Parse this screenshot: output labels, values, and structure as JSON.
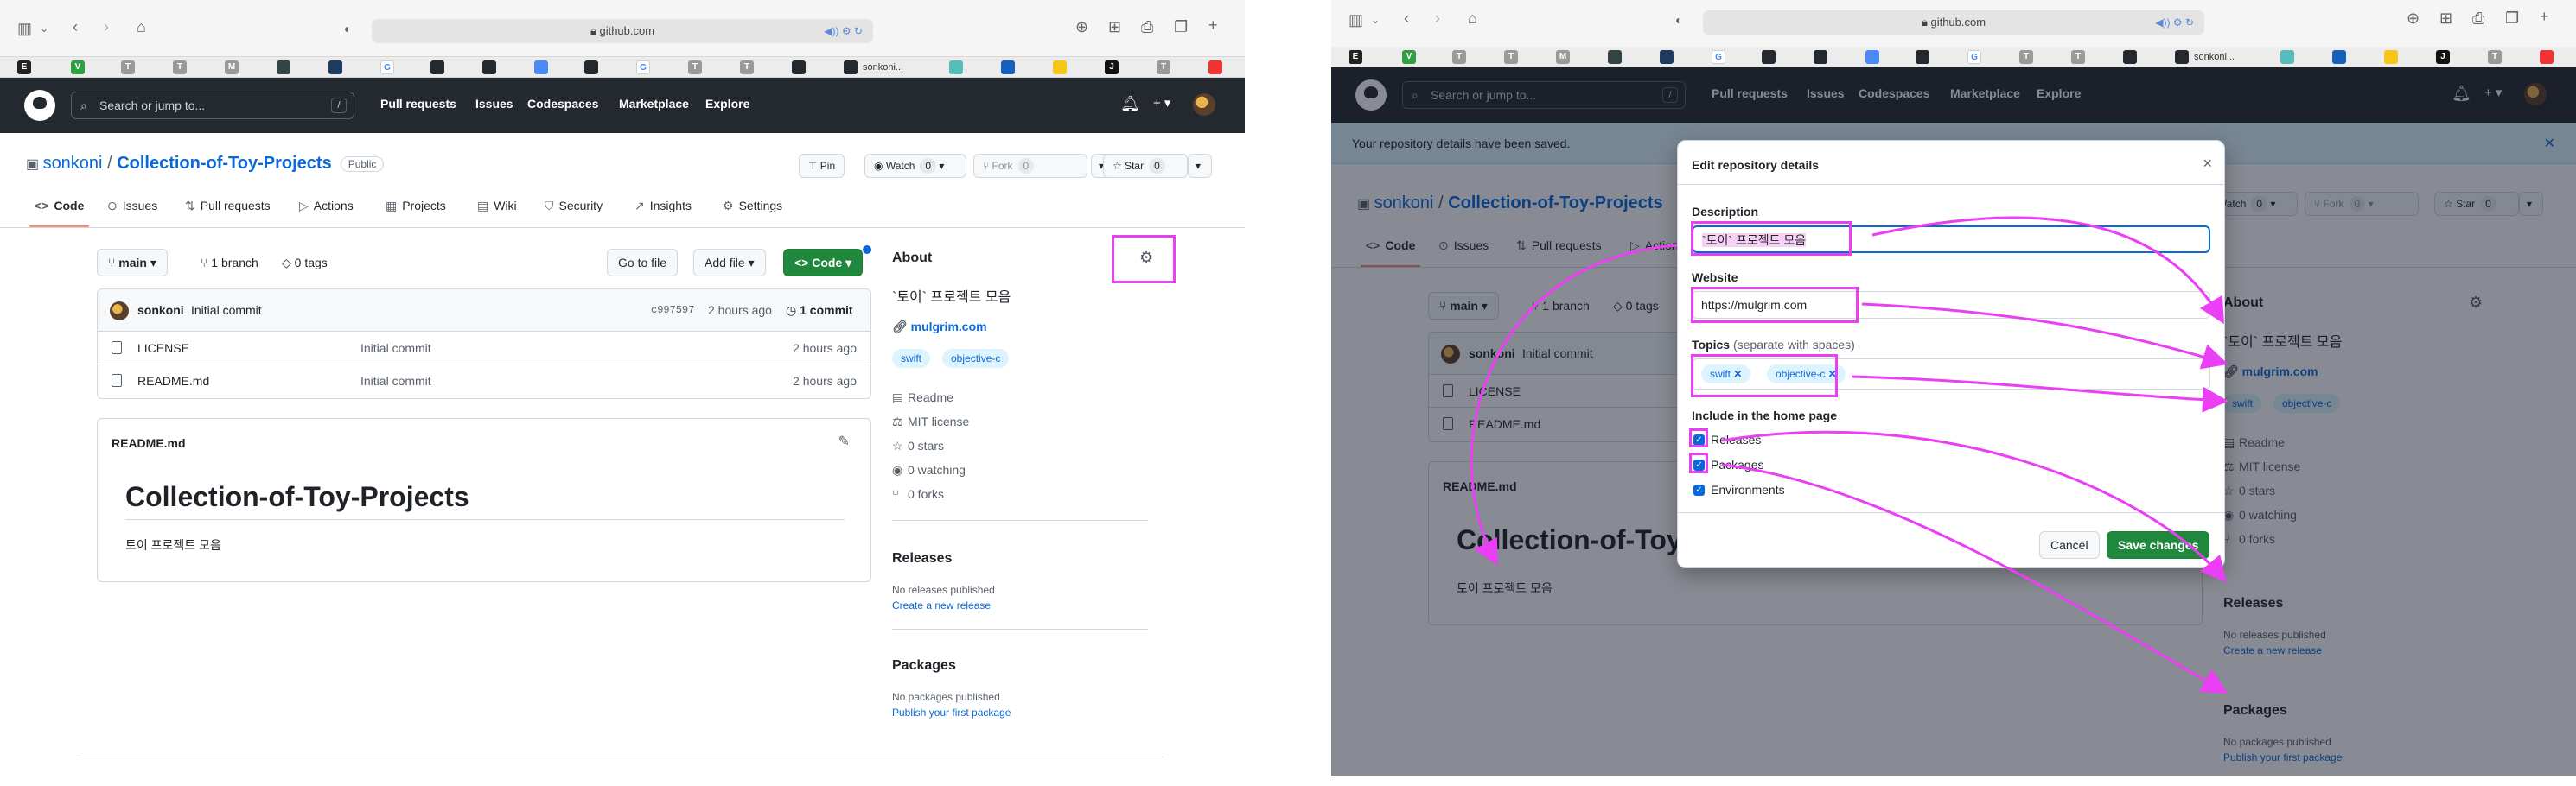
{
  "browser": {
    "url": "github.com",
    "favorites": [
      "E",
      "V",
      "T",
      "T",
      "M",
      "",
      "",
      "G",
      "",
      "",
      "",
      "",
      "",
      "G",
      "T",
      "T",
      "",
      "sonkoni…",
      "",
      "",
      "",
      "J",
      "T",
      ""
    ],
    "active_tab_label": "sonkoni..."
  },
  "github_header": {
    "search_placeholder": "Search or jump to...",
    "slash_key": "/",
    "nav": [
      "Pull requests",
      "Issues",
      "Codespaces",
      "Marketplace",
      "Explore"
    ],
    "plus_label": "+ ▾"
  },
  "repo": {
    "owner": "sonkoni",
    "separator": "/",
    "name": "Collection-of-Toy-Projects",
    "visibility": "Public",
    "pin_label": "Pin",
    "watch_label": "Watch",
    "watch_count": "0",
    "fork_label": "Fork",
    "fork_count": "0",
    "star_label": "Star",
    "star_count": "0"
  },
  "tabs": [
    {
      "icon": "<>",
      "label": "Code"
    },
    {
      "icon": "⊙",
      "label": "Issues"
    },
    {
      "icon": "⇅",
      "label": "Pull requests"
    },
    {
      "icon": "▷",
      "label": "Actions"
    },
    {
      "icon": "▦",
      "label": "Projects"
    },
    {
      "icon": "▤",
      "label": "Wiki"
    },
    {
      "icon": "⛉",
      "label": "Security"
    },
    {
      "icon": "↗",
      "label": "Insights"
    },
    {
      "icon": "⚙",
      "label": "Settings"
    }
  ],
  "branch_bar": {
    "branch": "main",
    "branches": "1 branch",
    "branches_num": "1",
    "tags": "0 tags",
    "go_to_file": "Go to file",
    "add_file": "Add file",
    "code": "Code"
  },
  "commit": {
    "author": "sonkoni",
    "message": "Initial commit",
    "hash": "c997597",
    "time": "2 hours ago",
    "count": "1 commit"
  },
  "files": [
    {
      "name": "LICENSE",
      "message": "Initial commit",
      "time": "2 hours ago"
    },
    {
      "name": "README.md",
      "message": "Initial commit",
      "time": "2 hours ago"
    }
  ],
  "readme": {
    "filename": "README.md",
    "title": "Collection-of-Toy-Projects",
    "body": "토이 프로젝트 모음"
  },
  "about": {
    "heading": "About",
    "description": "`토이` 프로젝트 모음",
    "website": "mulgrim.com",
    "topics": [
      "swift",
      "objective-c"
    ],
    "items": [
      {
        "icon": "book-icon",
        "label": "Readme"
      },
      {
        "icon": "scale-icon",
        "label": "MIT license"
      },
      {
        "icon": "star-icon",
        "label": "0 stars"
      },
      {
        "icon": "eye-icon",
        "label": "0 watching"
      },
      {
        "icon": "fork-icon",
        "label": "0 forks"
      }
    ]
  },
  "releases": {
    "heading": "Releases",
    "empty": "No releases published",
    "link": "Create a new release"
  },
  "packages": {
    "heading": "Packages",
    "empty": "No packages published",
    "link": "Publish your first package"
  },
  "flash": {
    "message": "Your repository details have been saved."
  },
  "modal": {
    "title": "Edit repository details",
    "close": "×",
    "description_label": "Description",
    "description_value": "`토이` 프로젝트 모음",
    "website_label": "Website",
    "website_value": "https://mulgrim.com",
    "topics_label": "Topics",
    "topics_hint": "(separate with spaces)",
    "topics": [
      "swift",
      "objective-c"
    ],
    "home_label": "Include in the home page",
    "checks": [
      {
        "label": "Releases",
        "checked": true
      },
      {
        "label": "Packages",
        "checked": true
      },
      {
        "label": "Environments",
        "checked": true
      }
    ],
    "cancel": "Cancel",
    "save": "Save changes"
  },
  "colors": {
    "highlight": "#ea3ff5",
    "header_bg": "#24292f",
    "link": "#0969da",
    "green": "#1f883d"
  }
}
